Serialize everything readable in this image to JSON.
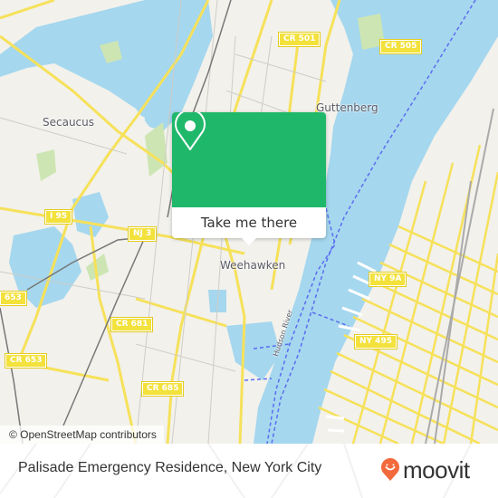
{
  "map": {
    "place_labels": {
      "secaucus": "Secaucus",
      "guttenberg": "Guttenberg",
      "weehawken": "Weehawken",
      "river": "Hudson River"
    },
    "road_shields": {
      "cr501": "CR 501",
      "cr505": "CR 505",
      "i95": "I 95",
      "nj3": "NJ 3",
      "cr653_top": "653",
      "cr653": "CR 653",
      "cr681": "CR 681",
      "cr685": "CR 685",
      "ny9a": "NY 9A",
      "ny495": "NY 495"
    },
    "attribution": "© OpenStreetMap contributors",
    "colors": {
      "water": "#a5d7ee",
      "land": "#f2f1ec",
      "road": "#f6e15a",
      "park": "#cde5b3",
      "ferry": "#5c6cf0"
    }
  },
  "popup": {
    "icon": "location-pin-icon",
    "button_label": "Take me there",
    "accent_color": "#1fb86a"
  },
  "footer": {
    "place_name": "Palisade Emergency Residence, New York City",
    "brand": "moovit",
    "brand_color": "#f26a3c"
  }
}
